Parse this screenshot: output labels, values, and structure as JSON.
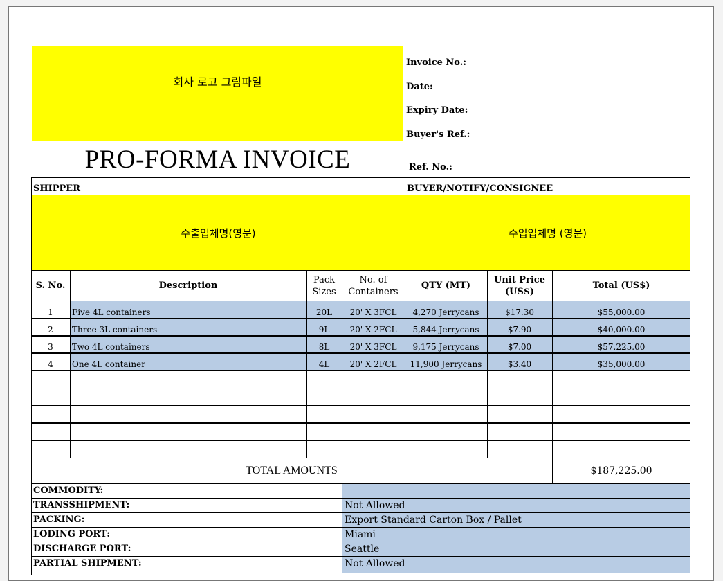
{
  "logo_placeholder": "회사 로고 그림파일",
  "meta": {
    "invoice_no": "Invoice No.:",
    "date": "Date:",
    "expiry_date": "Expiry Date:",
    "buyers_ref": "Buyer's Ref.:",
    "ref_no": "Ref. No.:"
  },
  "title": "PRO-FORMA INVOICE",
  "shipper": {
    "label": "SHIPPER",
    "value": "수출업체명(영문)"
  },
  "buyer": {
    "label": "BUYER/NOTIFY/CONSIGNEE",
    "value": "수입업체명 (영문)"
  },
  "columns": {
    "sno": "S. No.",
    "description": "Description",
    "pack_line1": "Pack",
    "pack_line2": "Sizes",
    "containers_line1": "No. of",
    "containers_line2": "Containers",
    "qty": "QTY (MT)",
    "unit_price_line1": "Unit Price",
    "unit_price_line2": "(US$)",
    "total": "Total (US$)"
  },
  "items": [
    {
      "sno": "1",
      "description": "Five 4L containers",
      "pack": "20L",
      "containers": "20' X 3FCL",
      "qty": "4,270 Jerrycans",
      "unit_price": "$17.30",
      "total": "$55,000.00"
    },
    {
      "sno": "2",
      "description": "Three 3L containers",
      "pack": "9L",
      "containers": "20' X 2FCL",
      "qty": "5,844 Jerrycans",
      "unit_price": "$7.90",
      "total": "$40,000.00"
    },
    {
      "sno": "3",
      "description": "Two 4L containers",
      "pack": "8L",
      "containers": "20' X 3FCL",
      "qty": "9,175 Jerrycans",
      "unit_price": "$7.00",
      "total": "$57,225.00"
    },
    {
      "sno": "4",
      "description": "One 4L container",
      "pack": "4L",
      "containers": "20' X 2FCL",
      "qty": "11,900 Jerrycans",
      "unit_price": "$3.40",
      "total": "$35,000.00"
    }
  ],
  "total_amounts_label": "TOTAL AMOUNTS",
  "total_amounts_value": "$187,225.00",
  "terms": {
    "commodity_label": "COMMODITY:",
    "commodity_value": "",
    "transshipment_label": "TRANSSHIPMENT:",
    "transshipment_value": "Not Allowed",
    "packing_label": "PACKING:",
    "packing_value": "Export Standard Carton Box / Pallet",
    "loading_port_label": "LODING PORT:",
    "loading_port_value": "Miami",
    "discharge_port_label": "DISCHARGE PORT:",
    "discharge_port_value": "Seattle",
    "partial_shipment_label": "PARTIAL SHIPMENT:",
    "partial_shipment_value": "Not Allowed"
  },
  "colors": {
    "highlight_yellow": "#ffff00",
    "row_blue": "#b8cce4"
  }
}
